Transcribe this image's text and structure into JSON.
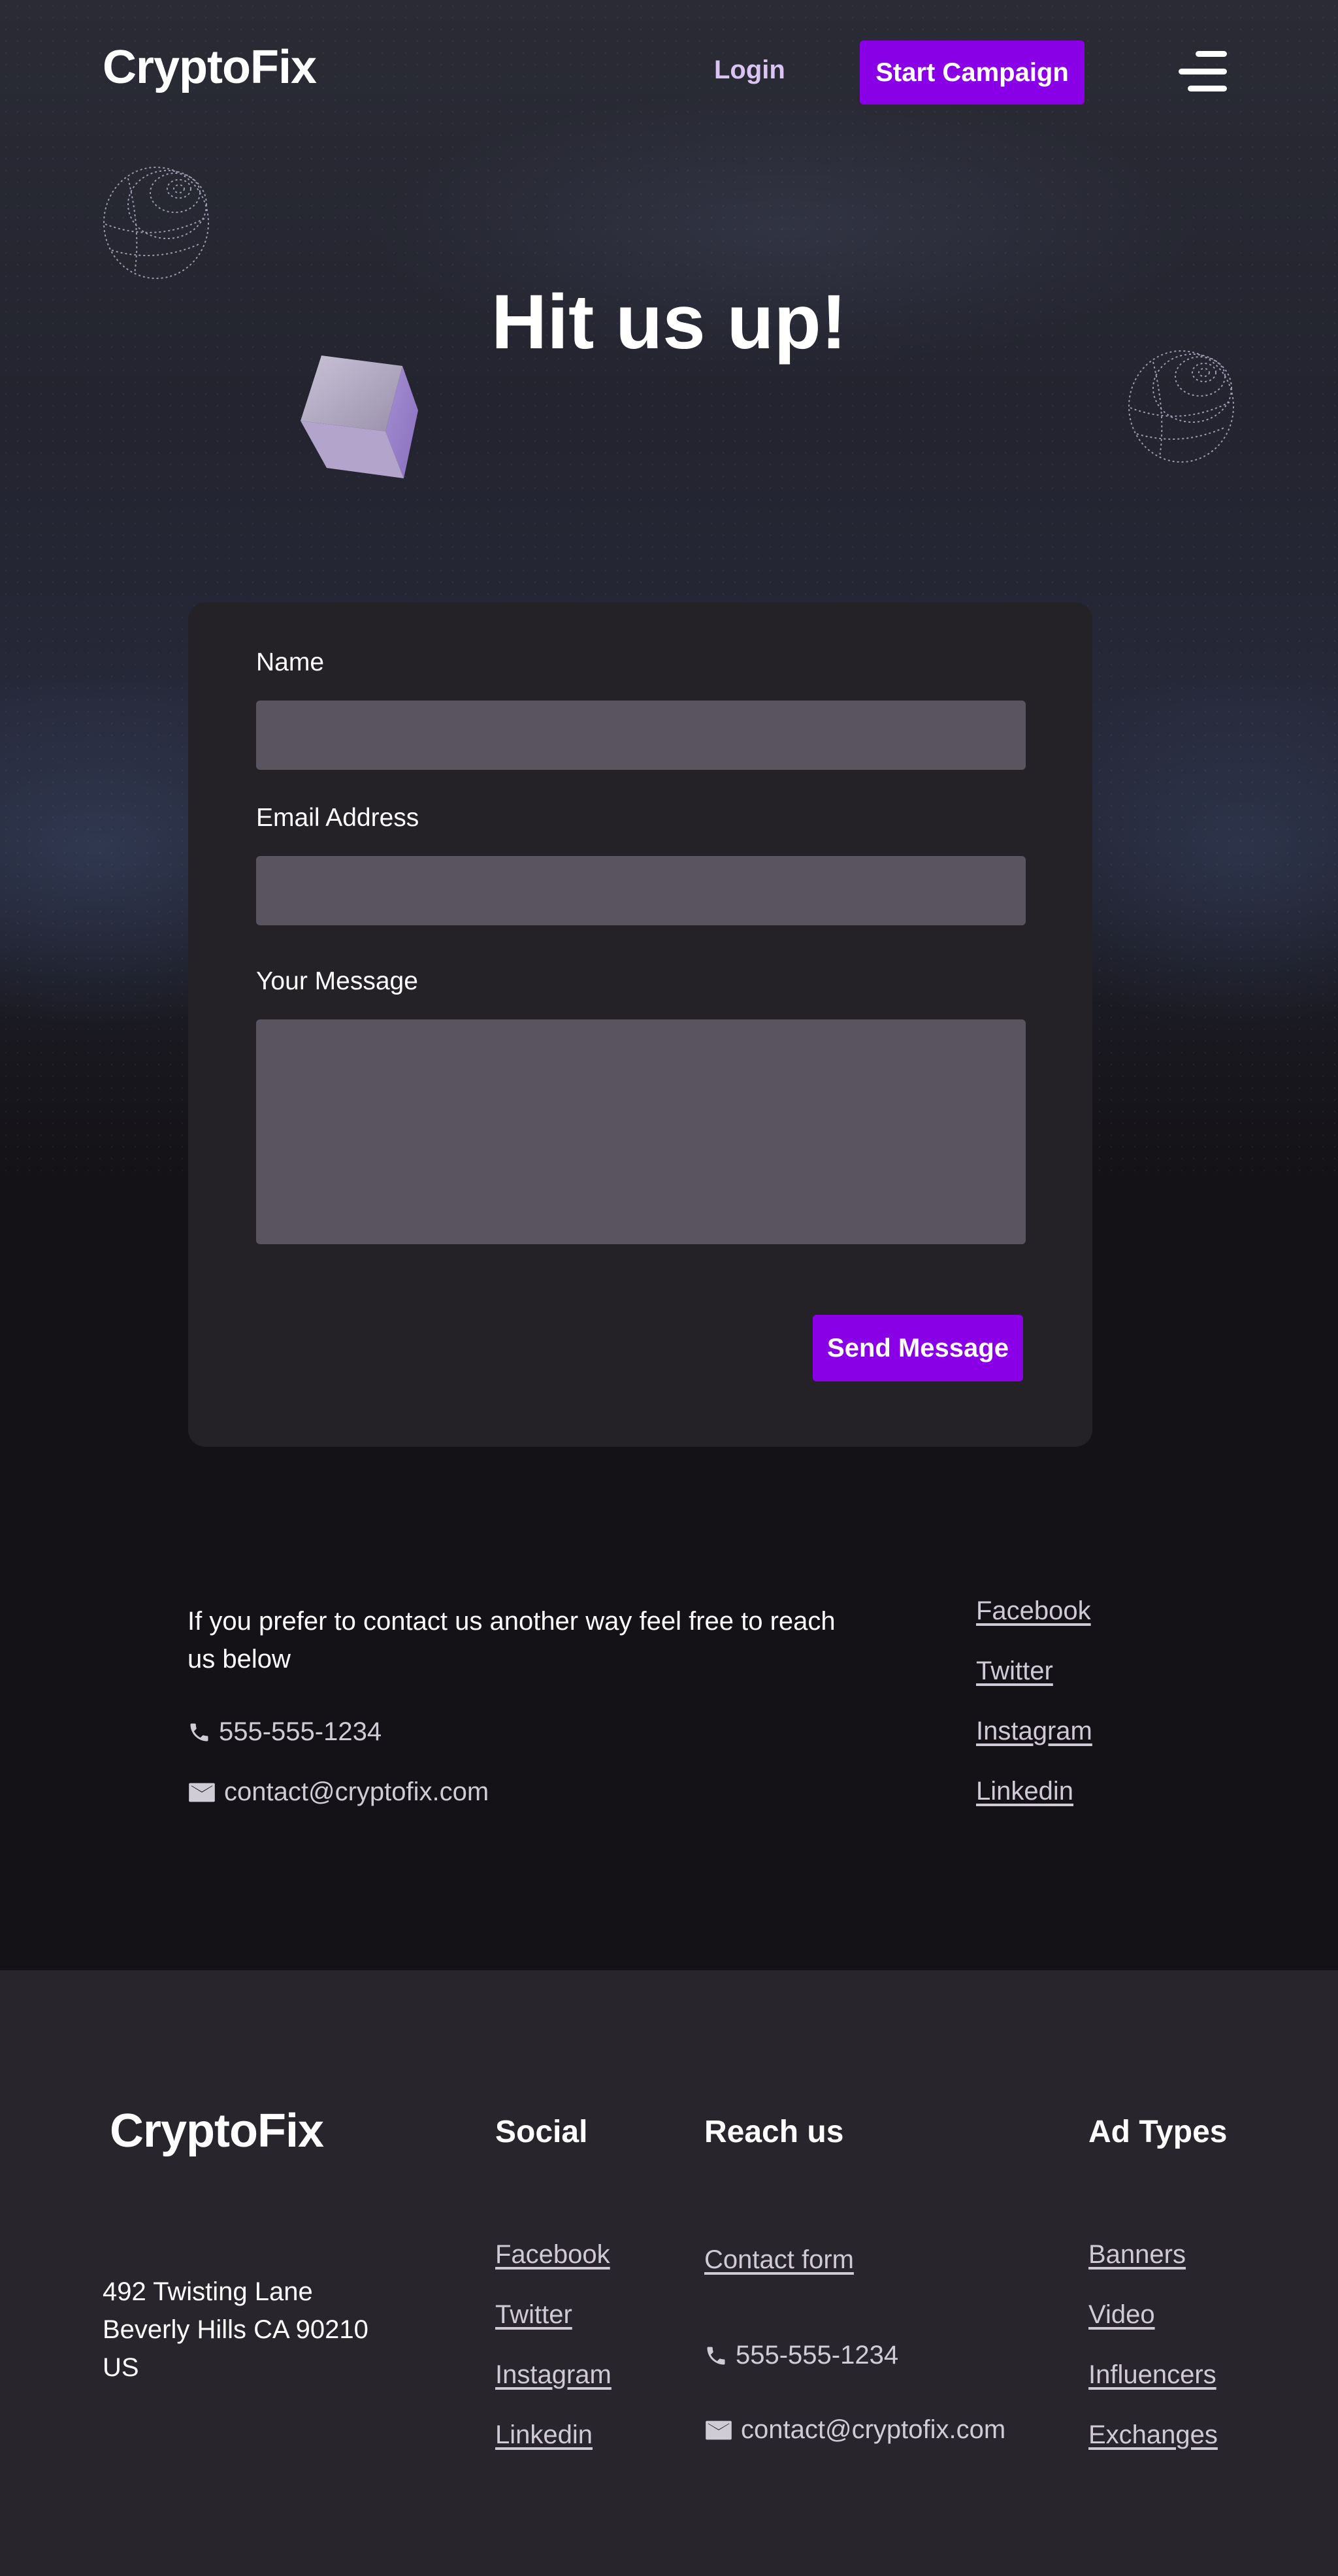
{
  "header": {
    "logo": "CryptoFix",
    "login_label": "Login",
    "campaign_label": "Start Campaign"
  },
  "hero": {
    "title": "Hit us up!"
  },
  "form": {
    "name_label": "Name",
    "name_value": "",
    "email_label": "Email Address",
    "email_value": "",
    "message_label": "Your Message",
    "message_value": "",
    "send_label": "Send Message"
  },
  "contact": {
    "intro": "If you prefer to contact us another way feel free to reach us below",
    "phone": "555-555-1234",
    "email": "contact@cryptofix.com",
    "links": [
      "Facebook",
      "Twitter",
      "Instagram",
      "Linkedin"
    ]
  },
  "footer": {
    "logo": "CryptoFix",
    "address_line1": "492 Twisting Lane",
    "address_line2": "Beverly Hills CA 90210",
    "address_line3": "US",
    "social_heading": "Social",
    "social_links": [
      "Facebook",
      "Twitter",
      "Instagram",
      "Linkedin"
    ],
    "reach_heading": "Reach us",
    "contact_form_label": "Contact form",
    "phone": "555-555-1234",
    "email": "contact@cryptofix.com",
    "adtypes_heading": "Ad Types",
    "adtypes_links": [
      "Banners",
      "Video",
      "Influencers",
      "Exchanges"
    ]
  },
  "colors": {
    "accent": "#8a00e6",
    "login_text": "#d9c4f2",
    "card": "#242127",
    "field": "#5a5461",
    "footer": "#28252c"
  },
  "icons": [
    "menu-icon",
    "globe-icon",
    "cube-icon",
    "phone-icon",
    "mail-icon"
  ]
}
